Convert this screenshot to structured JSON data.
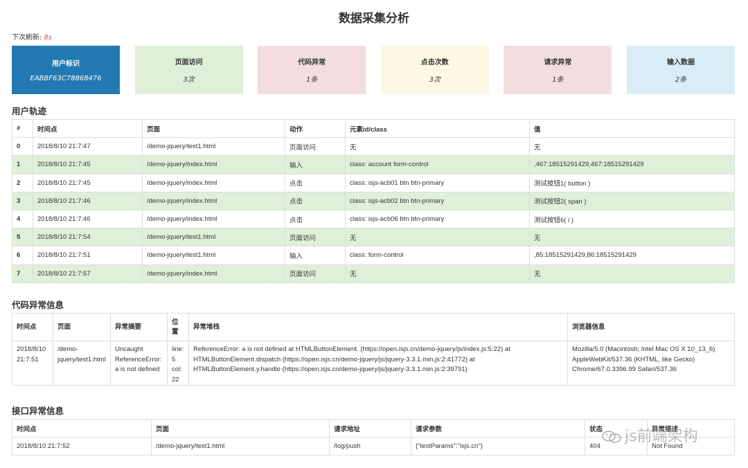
{
  "page_title": "数据采集分析",
  "refresh": {
    "label": "下次刷新:",
    "value": "8s"
  },
  "cards": [
    {
      "title": "用户标识",
      "value": "EABBF63C78868476"
    },
    {
      "title": "页面访问",
      "value": "3次"
    },
    {
      "title": "代码异常",
      "value": "1条"
    },
    {
      "title": "点击次数",
      "value": "3次"
    },
    {
      "title": "请求异常",
      "value": "1条"
    },
    {
      "title": "输入数据",
      "value": "2条"
    }
  ],
  "track": {
    "heading": "用户轨迹",
    "columns": [
      "#",
      "时间点",
      "页面",
      "动作",
      "元素id/class",
      "值"
    ],
    "rows": [
      [
        "0",
        "2018/8/10 21:7:47",
        "/demo-jquery/test1.html",
        "页面访问",
        "无",
        "无"
      ],
      [
        "1",
        "2018/8/10 21:7:45",
        "/demo-jquery/index.html",
        "输入",
        "class: account form-control",
        ",467:18515291429,467:18515291429"
      ],
      [
        "2",
        "2018/8/10 21:7:45",
        "/demo-jquery/index.html",
        "点击",
        "class: isjs-acb01 btn btn-primary",
        "测试按钮1( button )"
      ],
      [
        "3",
        "2018/8/10 21:7:46",
        "/demo-jquery/index.html",
        "点击",
        "class: isjs-acb02 btn btn-primary",
        "测试按钮2( span )"
      ],
      [
        "4",
        "2018/8/10 21:7:46",
        "/demo-jquery/index.html",
        "点击",
        "class: isjs-acb06 btn btn-primary",
        "测试按钮6( i )"
      ],
      [
        "5",
        "2018/8/10 21:7:54",
        "/demo-jquery/test1.html",
        "页面访问",
        "无",
        "无"
      ],
      [
        "6",
        "2018/8/10 21:7:51",
        "/demo-jquery/test1.html",
        "输入",
        "class: form-control",
        ",85:18515291429,86:18515291429"
      ],
      [
        "7",
        "2018/8/10 21:7:57",
        "/demo-jquery/index.html",
        "页面访问",
        "无",
        "无"
      ]
    ]
  },
  "code_errors": {
    "heading": "代码异常信息",
    "columns": [
      "时间点",
      "页面",
      "异常摘要",
      "位置",
      "异常堆栈",
      "浏览器信息"
    ],
    "rows": [
      [
        "2018/8/10 21:7:51",
        "/demo-jquery/test1.html",
        "Uncaught ReferenceError: a is not defined",
        "line: 5 col: 22",
        "ReferenceError: a is not defined at HTMLButtonElement. (https://open.isjs.cn/demo-jquery/js/index.js:5:22) at HTMLButtonElement.dispatch (https://open.isjs.cn/demo-jquery/js/jquery-3.3.1.min.js:2:41772) at HTMLButtonElement.y.handle (https://open.isjs.cn/demo-jquery/js/jquery-3.3.1.min.js:2:39791)",
        "Mozilla/5.0 (Macintosh; Intel Mac OS X 10_13_6) AppleWebKit/537.36 (KHTML, like Gecko) Chrome/67.0.3396.99 Safari/537.36"
      ]
    ]
  },
  "api_errors": {
    "heading": "接口异常信息",
    "columns": [
      "时间点",
      "页面",
      "请求地址",
      "请求参数",
      "状态",
      "异常描述"
    ],
    "rows": [
      [
        "2018/8/10 21:7:52",
        "/demo-jquery/test1.html",
        "/log/push",
        "{\"testParams\":\"isjs.cn\"}",
        "404",
        "Not Found"
      ]
    ]
  },
  "watermark": "js前端架构",
  "colors": {
    "primary": "#2379b2",
    "success": "#dff0d8",
    "danger": "#f2dede",
    "warning": "#fcf8e3",
    "info": "#d9edf7",
    "accent": "#d9534f"
  }
}
